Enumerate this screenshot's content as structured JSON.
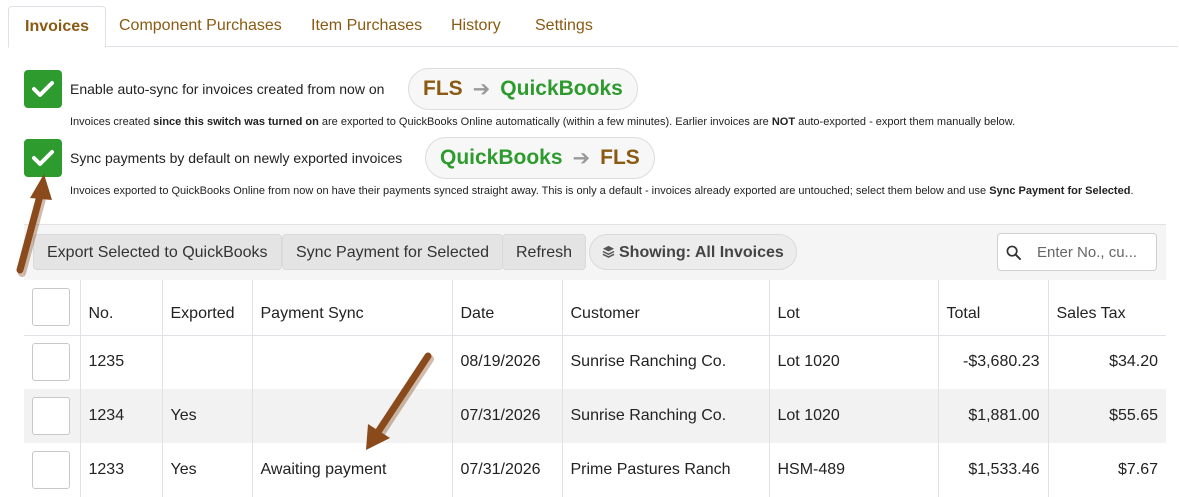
{
  "tabs": [
    "Invoices",
    "Component Purchases",
    "Item Purchases",
    "History",
    "Settings"
  ],
  "options": {
    "auto_sync": {
      "label": "Enable auto-sync for invoices created from now on",
      "checked": true,
      "pill": {
        "from": "FLS",
        "to": "QuickBooks"
      },
      "help_pre": "Invoices created ",
      "help_bold1": "since this switch was turned on",
      "help_mid": " are exported to QuickBooks Online automatically (within a few minutes). Earlier invoices are ",
      "help_bold2": "NOT",
      "help_post": " auto-exported - export them manually below."
    },
    "sync_payments": {
      "label": "Sync payments by default on newly exported invoices",
      "checked": true,
      "pill": {
        "from": "QuickBooks",
        "to": "FLS"
      },
      "help_pre": "Invoices exported to QuickBooks Online from now on have their payments synced straight away. This is only a default - invoices already exported are untouched; select them below and use ",
      "help_bold": "Sync Payment for Selected",
      "help_post": "."
    }
  },
  "toolbar": {
    "export_label": "Export Selected to QuickBooks",
    "sync_label": "Sync Payment for Selected",
    "refresh_label": "Refresh",
    "showing_label": "Showing: All Invoices",
    "search_placeholder": "Enter No., cu..."
  },
  "table": {
    "columns": [
      "No.",
      "Exported",
      "Payment Sync",
      "Date",
      "Customer",
      "Lot",
      "Total",
      "Sales Tax"
    ],
    "rows": [
      {
        "no": "1235",
        "exported": "",
        "payment_sync": "",
        "date": "08/19/2026",
        "customer": "Sunrise Ranching Co.",
        "lot": "Lot 1020",
        "total": "-$3,680.23",
        "sales_tax": "$34.20"
      },
      {
        "no": "1234",
        "exported": "Yes",
        "payment_sync": "",
        "date": "07/31/2026",
        "customer": "Sunrise Ranching Co.",
        "lot": "Lot 1020",
        "total": "$1,881.00",
        "sales_tax": "$55.65"
      },
      {
        "no": "1233",
        "exported": "Yes",
        "payment_sync": "Awaiting payment",
        "date": "07/31/2026",
        "customer": "Prime Pastures Ranch",
        "lot": "HSM-489",
        "total": "$1,533.46",
        "sales_tax": "$7.67"
      }
    ]
  },
  "colors": {
    "brand_brown": "#8a5a12",
    "brand_green": "#2e9b2e",
    "annotation_arrow": "#8a4a1c"
  },
  "icons": {
    "checkbox": "check-icon",
    "flow_arrow": "arrow-right-icon",
    "layers": "layers-icon",
    "search": "search-icon"
  }
}
